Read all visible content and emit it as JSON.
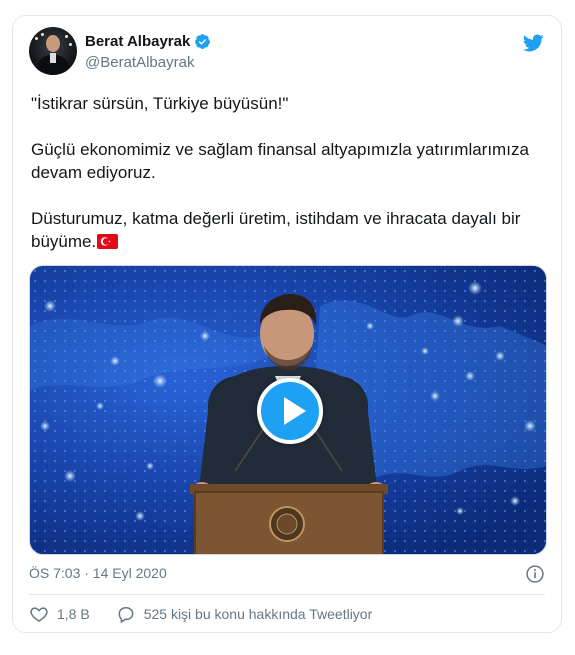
{
  "tweet": {
    "author_name": "Berat Albayrak",
    "author_handle": "@BeratAlbayrak",
    "text_lines": [
      "\"İstikrar sürsün, Türkiye büyüsün!\"",
      "Güçlü ekonomimiz ve sağlam finansal altyapımızla yatırımlarımıza devam ediyoruz.",
      "Düsturumuz, katma değerli üretim, istihdam ve ihracata dayalı bir büyüme."
    ],
    "flag_emoji": "turkey-flag",
    "timestamp": "ÖS 7:03 · 14 Eyl 2020",
    "likes": "1,8 B",
    "conversation": "525 kişi bu konu hakkında Tweetliyor"
  },
  "colors": {
    "accent": "#1da1f2",
    "text": "#14171a",
    "muted": "#657786",
    "border": "#e1e8ed",
    "flag_red": "#e30a17"
  },
  "icons": {
    "logo": "twitter-bird-icon",
    "verified": "verified-badge-icon",
    "info": "info-icon",
    "like": "heart-icon",
    "reply": "speech-bubble-icon",
    "play": "play-icon"
  }
}
